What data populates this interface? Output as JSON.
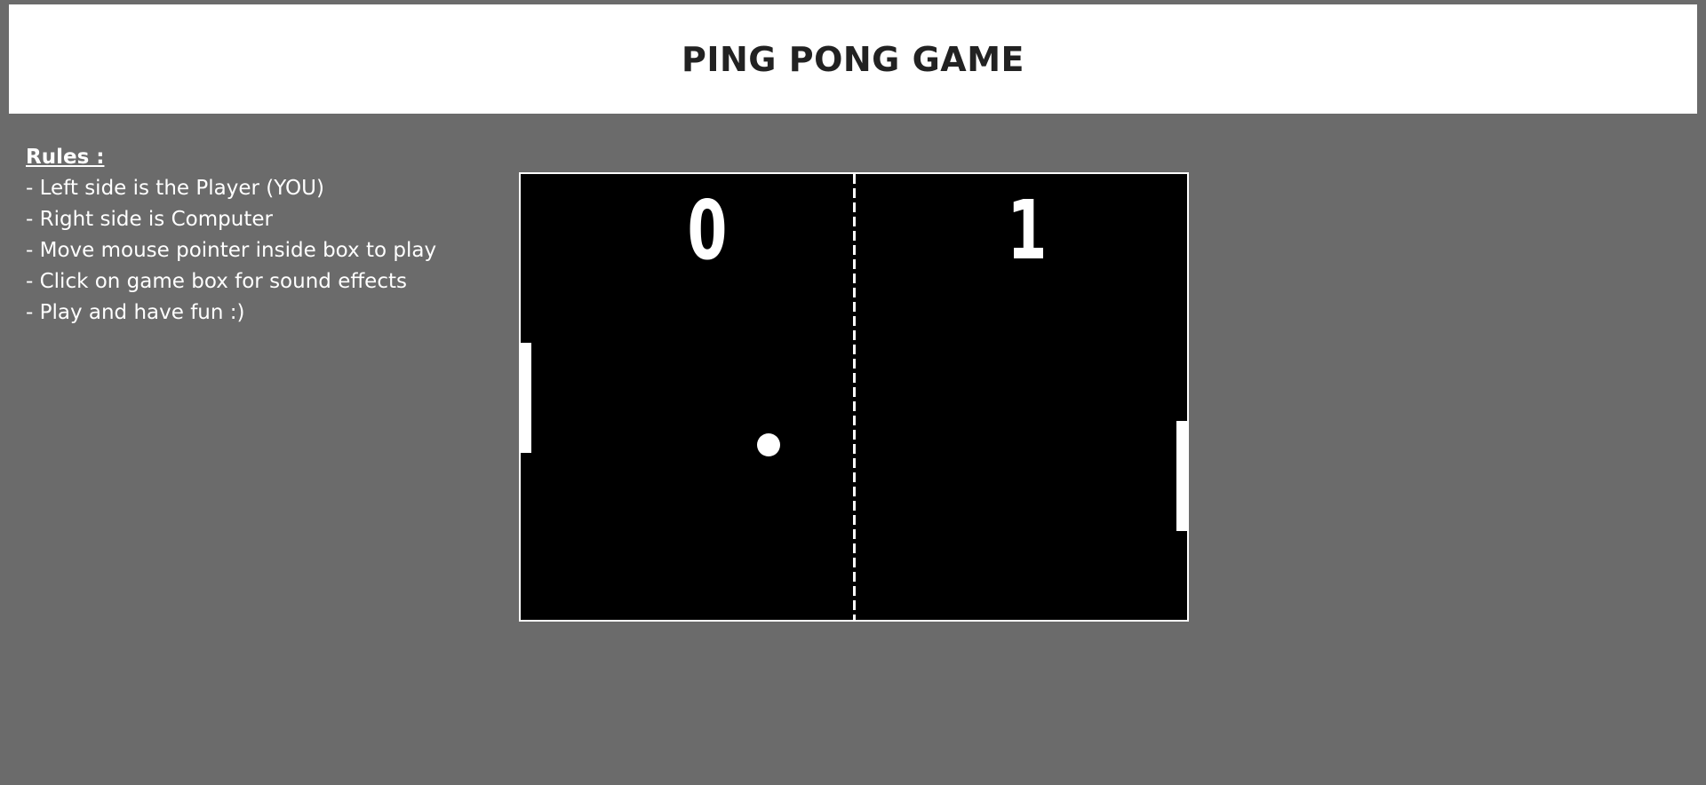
{
  "header": {
    "title": "PING PONG GAME"
  },
  "rules": {
    "title": "Rules :",
    "lines": [
      "- Left side is the Player (YOU)",
      "- Right side is Computer",
      "- Move mouse pointer inside box to play",
      "- Click on game box for sound effects",
      "- Play and have fun :)"
    ]
  },
  "game": {
    "player_score": "0",
    "computer_score": "1"
  },
  "colors": {
    "page_background": "#6b6b6b",
    "header_background": "#ffffff",
    "game_background": "#000000",
    "game_foreground": "#ffffff"
  }
}
